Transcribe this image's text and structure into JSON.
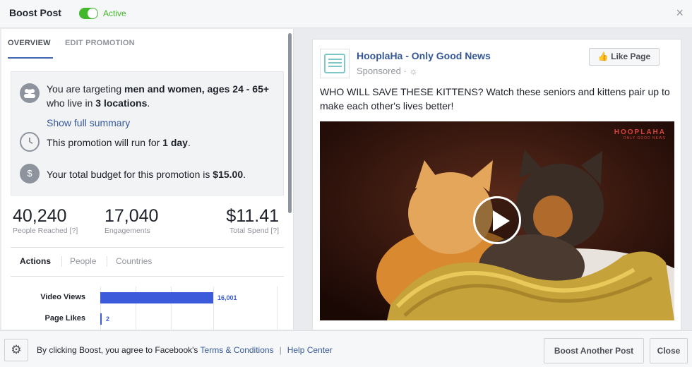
{
  "header": {
    "title": "Boost Post",
    "toggle_label": "Active",
    "toggle_on": true,
    "close_glyph": "×"
  },
  "tabs": [
    {
      "label": "OVERVIEW",
      "active": true
    },
    {
      "label": "EDIT PROMOTION",
      "active": false
    }
  ],
  "summary": {
    "targeting_prefix": "You are targeting ",
    "targeting_audience": "men and women, ages 24 - 65+",
    "targeting_mid": " who live in ",
    "targeting_locations": "3 locations",
    "targeting_suffix": ".",
    "show_summary_link": "Show full summary",
    "duration_prefix": "This promotion will run for ",
    "duration_value": "1 day",
    "duration_suffix": ".",
    "budget_prefix": "Your total budget for this promotion is ",
    "budget_value": "$15.00",
    "budget_suffix": ".",
    "icons": [
      "people-icon",
      "clock-icon",
      "dollar-icon"
    ]
  },
  "stats": {
    "reach": {
      "value": "40,240",
      "label": "People Reached [?]"
    },
    "engagements": {
      "value": "17,040",
      "label": "Engagements"
    },
    "spend": {
      "value": "$11.41",
      "label": "Total Spend [?]"
    }
  },
  "subtabs": [
    {
      "label": "Actions",
      "active": true
    },
    {
      "label": "People",
      "active": false
    },
    {
      "label": "Countries",
      "active": false
    }
  ],
  "chart_data": {
    "type": "bar",
    "orientation": "horizontal",
    "categories": [
      "Video Views",
      "Page Likes"
    ],
    "values": [
      16001,
      2
    ],
    "value_labels": [
      "16,001",
      "2"
    ],
    "xlim": [
      0,
      16001
    ],
    "bar_color": "#3b5bdb",
    "grid": true
  },
  "preview": {
    "page_name": "HooplaHa - Only Good News",
    "sponsored": "Sponsored · ",
    "like_button": "Like Page",
    "post_text": "WHO WILL SAVE THESE KITTENS? Watch these seniors and kittens pair up to make each other's lives better!",
    "watermark_main": "HOOPLAHA",
    "watermark_sub": "ONLY GOOD NEWS",
    "play_icon": "play-icon"
  },
  "footer": {
    "consent_prefix": "By clicking Boost, you agree to Facebook's ",
    "terms_link": "Terms & Conditions",
    "separator": "|",
    "help_link": "Help Center",
    "boost_another": "Boost Another Post",
    "close": "Close"
  },
  "colors": {
    "accent": "#4267b2",
    "active_green": "#42b72a",
    "link": "#365899",
    "bar": "#3b5bdb"
  }
}
